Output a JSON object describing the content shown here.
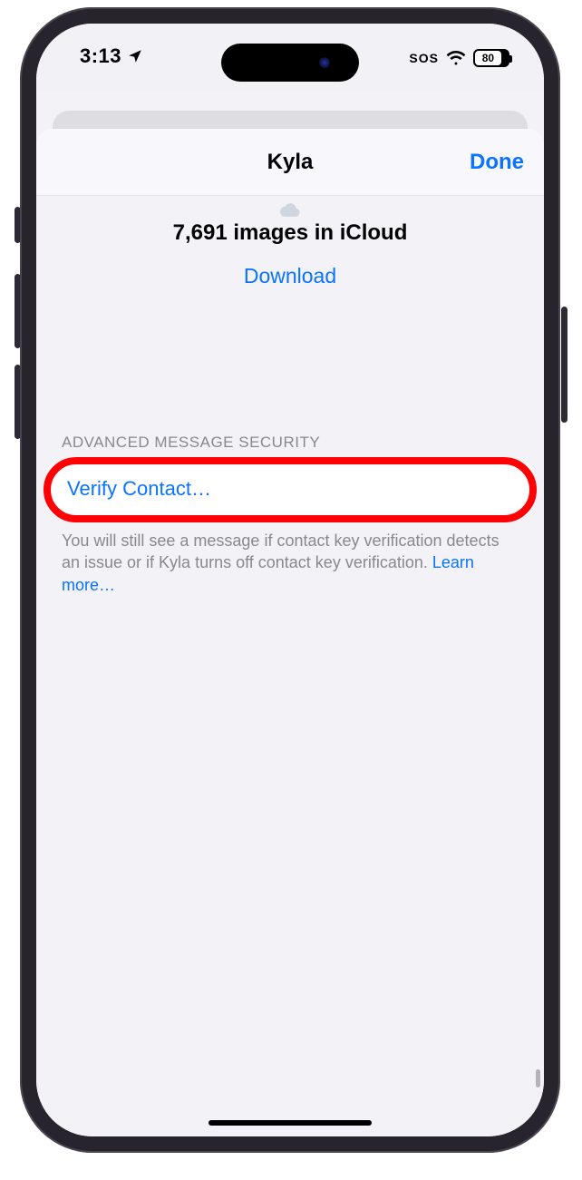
{
  "status": {
    "time": "3:13",
    "sos": "SOS",
    "battery": "80"
  },
  "sheet": {
    "title": "Kyla",
    "done": "Done",
    "images_line": "7,691 images in iCloud",
    "download": "Download"
  },
  "section": {
    "header": "ADVANCED MESSAGE SECURITY",
    "verify_label": "Verify Contact…",
    "footer_pre": "You will still see a message if contact key verification detects an issue or if Kyla turns off contact key verification. ",
    "learn_more": "Learn more…"
  }
}
